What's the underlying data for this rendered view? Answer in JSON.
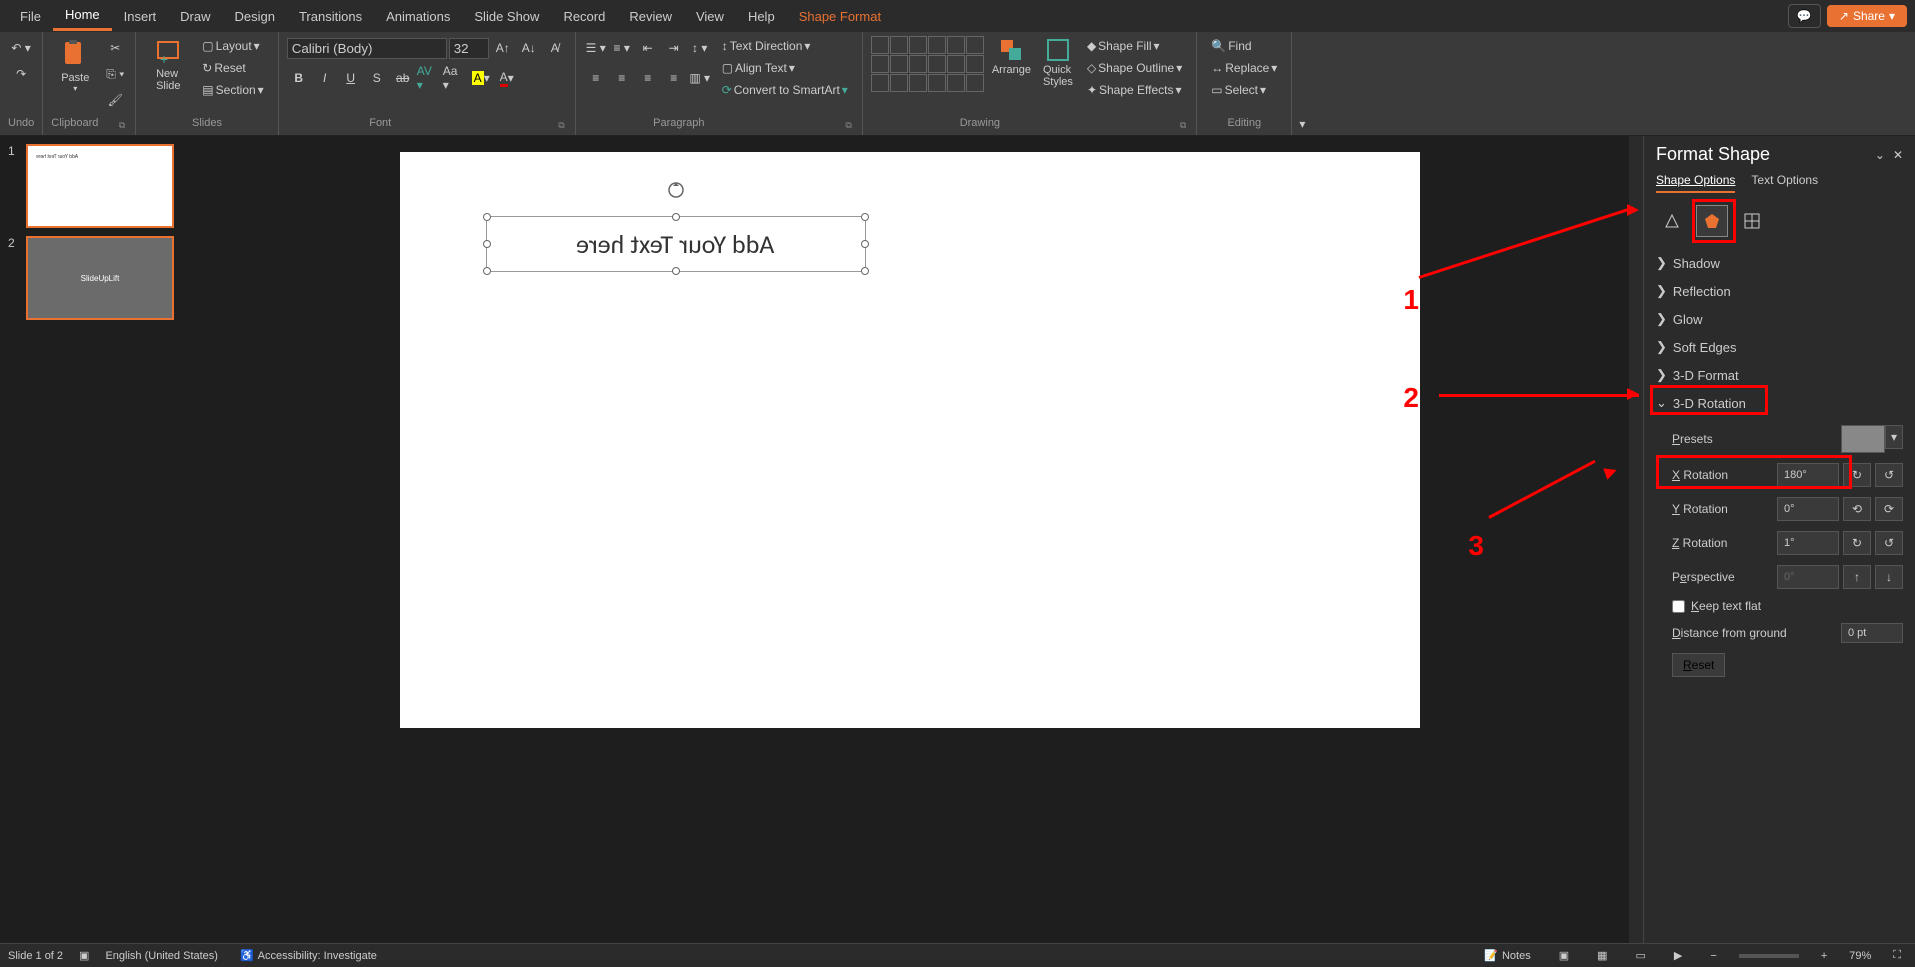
{
  "menubar": {
    "items": [
      "File",
      "Home",
      "Insert",
      "Draw",
      "Design",
      "Transitions",
      "Animations",
      "Slide Show",
      "Record",
      "Review",
      "View",
      "Help",
      "Shape Format"
    ],
    "active": "Home",
    "share": "Share"
  },
  "ribbon": {
    "undo": {
      "label": "Undo"
    },
    "clipboard": {
      "label": "Clipboard",
      "paste": "Paste"
    },
    "slides": {
      "label": "Slides",
      "new_slide": "New\nSlide",
      "layout": "Layout",
      "reset": "Reset",
      "section": "Section"
    },
    "font": {
      "label": "Font",
      "name": "Calibri (Body)",
      "size": "32"
    },
    "paragraph": {
      "label": "Paragraph",
      "text_direction": "Text Direction",
      "align_text": "Align Text",
      "smartart": "Convert to SmartArt"
    },
    "drawing": {
      "label": "Drawing",
      "arrange": "Arrange",
      "quick_styles": "Quick\nStyles",
      "shape_fill": "Shape Fill",
      "shape_outline": "Shape Outline",
      "shape_effects": "Shape Effects"
    },
    "editing": {
      "label": "Editing",
      "find": "Find",
      "replace": "Replace",
      "select": "Select"
    }
  },
  "thumbnails": {
    "slide1_text": "Add Your Text here",
    "slide2_text": "SlideUpLift"
  },
  "slide": {
    "textbox": "Add Your Text here"
  },
  "annotations": {
    "n1": "1",
    "n2": "2",
    "n3": "3"
  },
  "format_pane": {
    "title": "Format Shape",
    "tabs": {
      "shape": "Shape Options",
      "text": "Text Options"
    },
    "sections": {
      "shadow": "Shadow",
      "reflection": "Reflection",
      "glow": "Glow",
      "soft_edges": "Soft Edges",
      "format_3d": "3-D Format",
      "rotation_3d": "3-D Rotation"
    },
    "rotation": {
      "presets": "Presets",
      "x_label": "X Rotation",
      "x_value": "180°",
      "y_label": "Y Rotation",
      "y_value": "0°",
      "z_label": "Z Rotation",
      "z_value": "1°",
      "perspective": "Perspective",
      "perspective_value": "0°",
      "keep_flat": "Keep text flat",
      "distance": "Distance from ground",
      "distance_value": "0 pt",
      "reset": "Reset"
    }
  },
  "statusbar": {
    "slide": "Slide 1 of 2",
    "language": "English (United States)",
    "accessibility": "Accessibility: Investigate",
    "notes": "Notes",
    "zoom": "79%"
  }
}
